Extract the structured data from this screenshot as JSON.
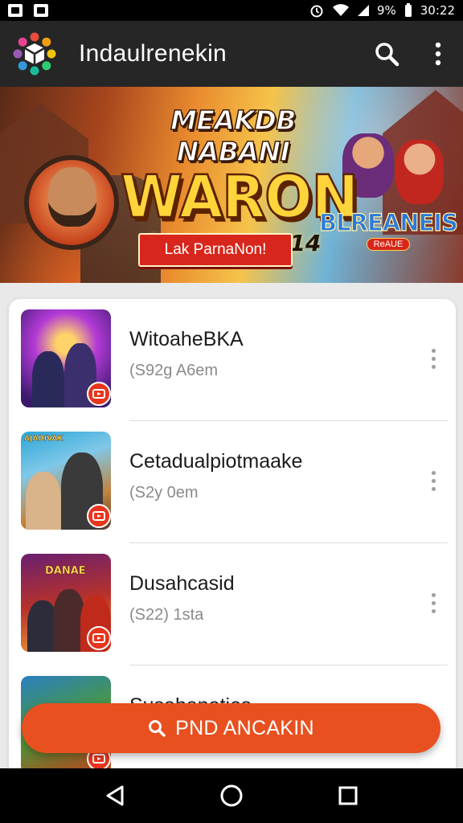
{
  "status_bar": {
    "signal_text": "9%",
    "time": "30:22"
  },
  "app_bar": {
    "title": "Indaulrenekin",
    "icons": [
      "app-logo",
      "search-icon",
      "more-vert-icon"
    ]
  },
  "banner": {
    "kicker": "MEAKDB NABANI",
    "title": "WARON",
    "subtitle": "14 VITGON 14",
    "cta_label": "Lak ParnaNon!",
    "badge_text": "BLREANEIS",
    "badge_chip": "ReAUE"
  },
  "games": [
    {
      "name": "WitoaheBKA",
      "meta": "(S92g A6em",
      "thumb_tag": ""
    },
    {
      "name": "Cetadualpiotmaake",
      "meta": "(S2y 0em",
      "thumb_tag": "AJADIVAK"
    },
    {
      "name": "Dusahcasid",
      "meta": "(S22) 1sta",
      "thumb_tag": "DANAE"
    },
    {
      "name": "Susahanaties",
      "meta": "",
      "thumb_tag": ""
    }
  ],
  "fab": {
    "label": "PND ANCAKIN",
    "icon": "search-icon"
  },
  "nav_bar": {
    "icons": [
      "back-icon",
      "home-icon",
      "recents-icon"
    ]
  },
  "colors": {
    "app_bar": "#262626",
    "accent": "#e8501f",
    "badge_red": "#e8351d"
  }
}
